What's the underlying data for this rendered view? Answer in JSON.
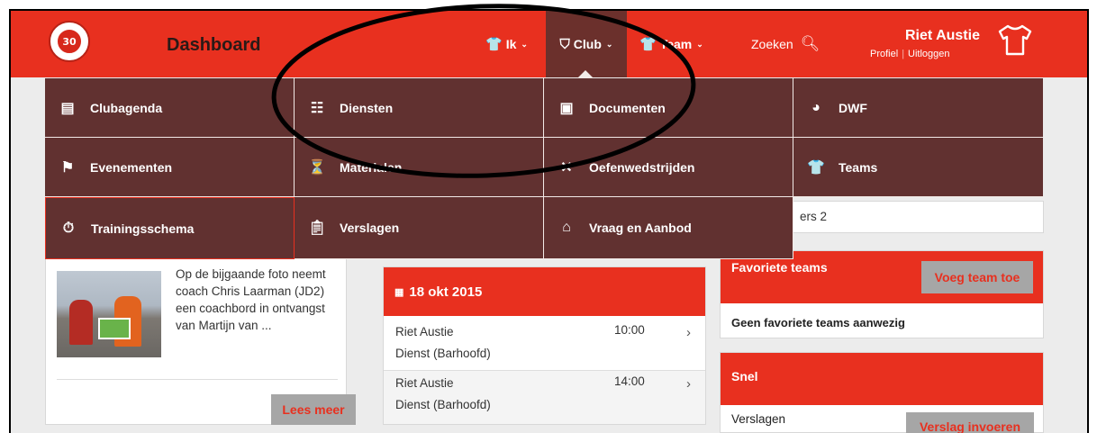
{
  "header": {
    "brand": "Dashboard",
    "logo_text": "30",
    "nav": [
      {
        "label": "Ik",
        "icon": "shirt-icon"
      },
      {
        "label": "Club",
        "icon": "shield-icon"
      },
      {
        "label": "Team",
        "icon": "shirts-icon"
      }
    ],
    "search_label": "Zoeken",
    "user": {
      "name": "Riet Austie",
      "profile_link": "Profiel",
      "logout_link": "Uitloggen"
    }
  },
  "club_menu": [
    {
      "label": "Clubagenda",
      "icon": "calendar-icon"
    },
    {
      "label": "Diensten",
      "icon": "list-icon"
    },
    {
      "label": "Documenten",
      "icon": "document-icon"
    },
    {
      "label": "DWF",
      "icon": "dwf-badge-icon"
    },
    {
      "label": "Evenementen",
      "icon": "flag-icon"
    },
    {
      "label": "Materialen",
      "icon": "cone-icon"
    },
    {
      "label": "Oefenwedstrijden",
      "icon": "crossed-swords-icon"
    },
    {
      "label": "Teams",
      "icon": "shirts-icon"
    },
    {
      "label": "Trainingsschema",
      "icon": "stopwatch-icon"
    },
    {
      "label": "Verslagen",
      "icon": "clipboard-icon"
    },
    {
      "label": "Vraag en Aanbod",
      "icon": "shop-icon"
    }
  ],
  "news": {
    "text": "Op de bijgaande foto neemt coach Chris Laarman (JD2) een coachbord in ontvangst van Martijn van ...",
    "read_more": "Lees meer"
  },
  "agenda": {
    "date": "18 okt 2015",
    "items": [
      {
        "name": "Riet Austie",
        "time": "10:00",
        "role": "Dienst (Barhoofd)"
      },
      {
        "name": "Riet Austie",
        "time": "14:00",
        "role": "Dienst (Barhoofd)"
      }
    ]
  },
  "aside_strip": "ers 2",
  "favorites": {
    "title": "Favoriete teams",
    "add_button": "Voeg team toe",
    "empty_text": "Geen favoriete teams aanwezig"
  },
  "snel": {
    "title": "Snel",
    "label": "Verslagen",
    "button": "Verslag invoeren"
  },
  "colors": {
    "brand_red": "#e8301f",
    "menu_brown": "#613130",
    "button_gray": "#a6a6a6"
  }
}
